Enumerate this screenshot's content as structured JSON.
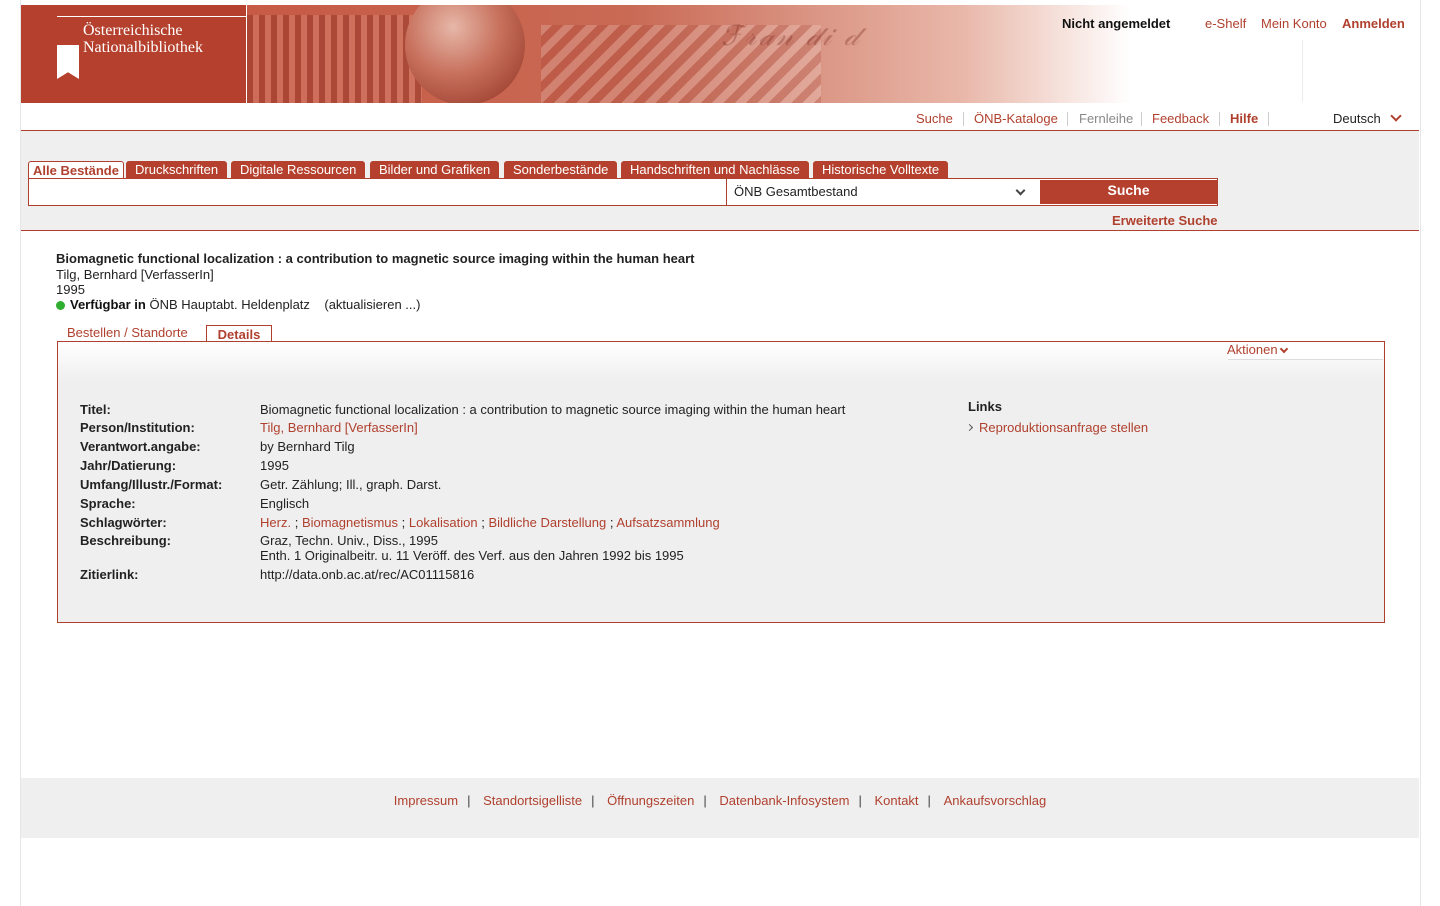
{
  "header": {
    "logo_line1": "Österreichische",
    "logo_line2": "Nationalbibliothek",
    "user_status": "Nicht angemeldet",
    "eshelf": "e-Shelf",
    "mein_konto": "Mein Konto",
    "anmelden": "Anmelden"
  },
  "nav": {
    "suche": "Suche",
    "kataloge": "ÖNB-Kataloge",
    "fernleihe": "Fernleihe",
    "feedback": "Feedback",
    "hilfe": "Hilfe",
    "language": "Deutsch"
  },
  "search": {
    "tabs": [
      "Alle Bestände",
      "Druckschriften",
      "Digitale Ressourcen",
      "Bilder und Grafiken",
      "Sonderbestände",
      "Handschriften und Nachlässe",
      "Historische Volltexte"
    ],
    "query": "",
    "scope": "ÖNB Gesamtbestand",
    "button": "Suche",
    "advanced": "Erweiterte Suche"
  },
  "record": {
    "title": "Biomagnetic functional localization : a contribution to magnetic source imaging within the human heart",
    "author": "Tilg, Bernhard [VerfasserIn]",
    "year": "1995",
    "available_label": "Verfügbar in",
    "location": "ÖNB Hauptabt. Heldenplatz",
    "refresh": "(aktualisieren ...)"
  },
  "detail_tabs": {
    "bestellen": "Bestellen / Standorte",
    "details": "Details"
  },
  "actions_label": "Aktionen",
  "details": {
    "titel_label": "Titel:",
    "titel": "Biomagnetic functional localization : a contribution to magnetic source imaging within the human heart",
    "person_label": "Person/Institution:",
    "person": "Tilg, Bernhard [VerfasserIn]",
    "verantwort_label": "Verantwort.angabe:",
    "verantwort": "by Bernhard Tilg",
    "jahr_label": "Jahr/Datierung:",
    "jahr": "1995",
    "umfang_label": "Umfang/Illustr./Format:",
    "umfang": "Getr. Zählung; Ill., graph. Darst.",
    "sprache_label": "Sprache:",
    "sprache": "Englisch",
    "schlag_label": "Schlagwörter:",
    "schlagwoerter": [
      "Herz.",
      "Biomagnetismus",
      "Lokalisation",
      "Bildliche Darstellung",
      "Aufsatzsammlung"
    ],
    "sep": ";",
    "beschreibung_label": "Beschreibung:",
    "beschreibung_1": "Graz, Techn. Univ., Diss., 1995",
    "beschreibung_2": "Enth. 1 Originalbeitr. u. 11 Veröff. des Verf. aus den Jahren 1992 bis 1995",
    "zitier_label": "Zitierlink:",
    "zitierlink": "http://data.onb.ac.at/rec/AC01115816"
  },
  "links": {
    "title": "Links",
    "item": "Reproduktionsanfrage stellen"
  },
  "footer": {
    "items": [
      "Impressum",
      "Standortsigelliste",
      "Öffnungszeiten",
      "Datenbank-Infosystem",
      "Kontakt",
      "Ankaufsvorschlag"
    ],
    "separator": "|"
  },
  "colors": {
    "brand": "#b4402d",
    "panel_bg": "#efefef",
    "available": "#2fae2f"
  }
}
